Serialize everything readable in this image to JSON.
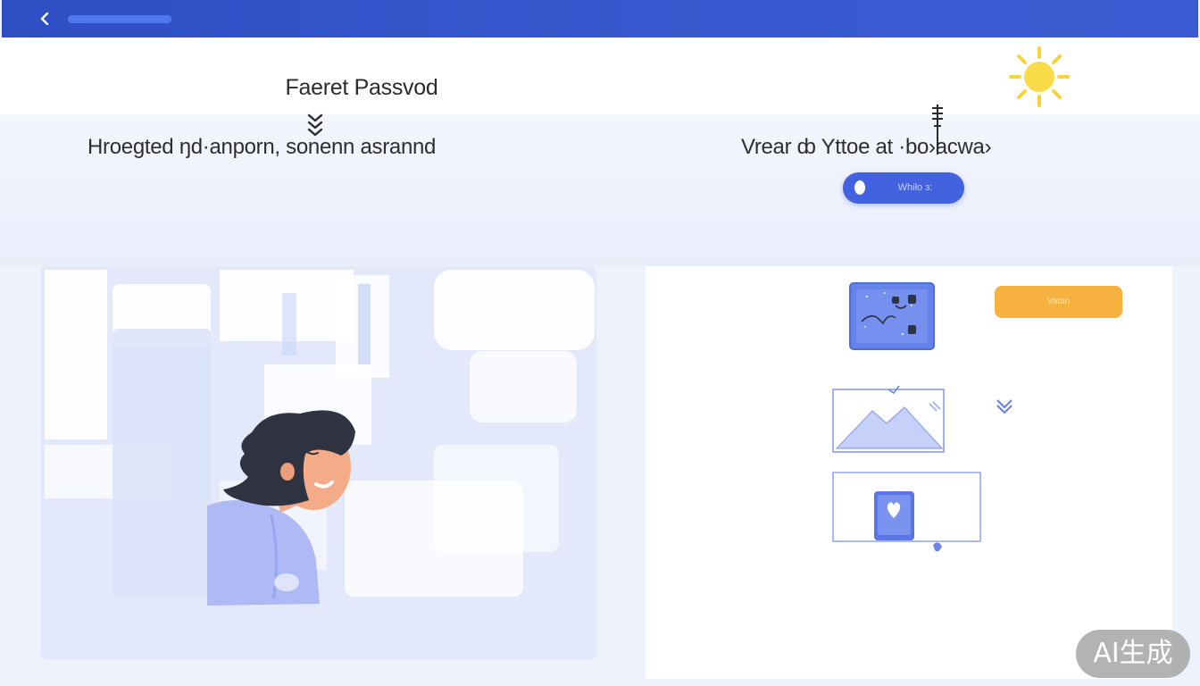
{
  "topbar": {
    "back_icon": "chevron-left-icon",
    "progress": 1.0
  },
  "header": {
    "title": "Faeret Passvod"
  },
  "left": {
    "subtitle": "Hroegted ŋd·anporn, sonenn asrannd"
  },
  "right": {
    "subtitle": "Vrear ȸ Yttoe at ·bo›acwa›",
    "primary_button_label": "Whiło ɜ:",
    "secondary_button_label": "Vatan"
  },
  "badge": {
    "label": "AI生成"
  },
  "colors": {
    "brand_blue": "#3a5bd1",
    "accent_orange": "#f6b13e",
    "sun_yellow": "#f9d33a",
    "panel_tint": "#e3e9fb"
  },
  "icons": {
    "sun": "sun-icon",
    "chevrons": "double-chevron-down-icon",
    "photo_card": "photo-card-icon",
    "landscape": "landscape-image-icon",
    "heart_card": "heart-card-icon",
    "arrow_down": "arrow-down-icon"
  }
}
